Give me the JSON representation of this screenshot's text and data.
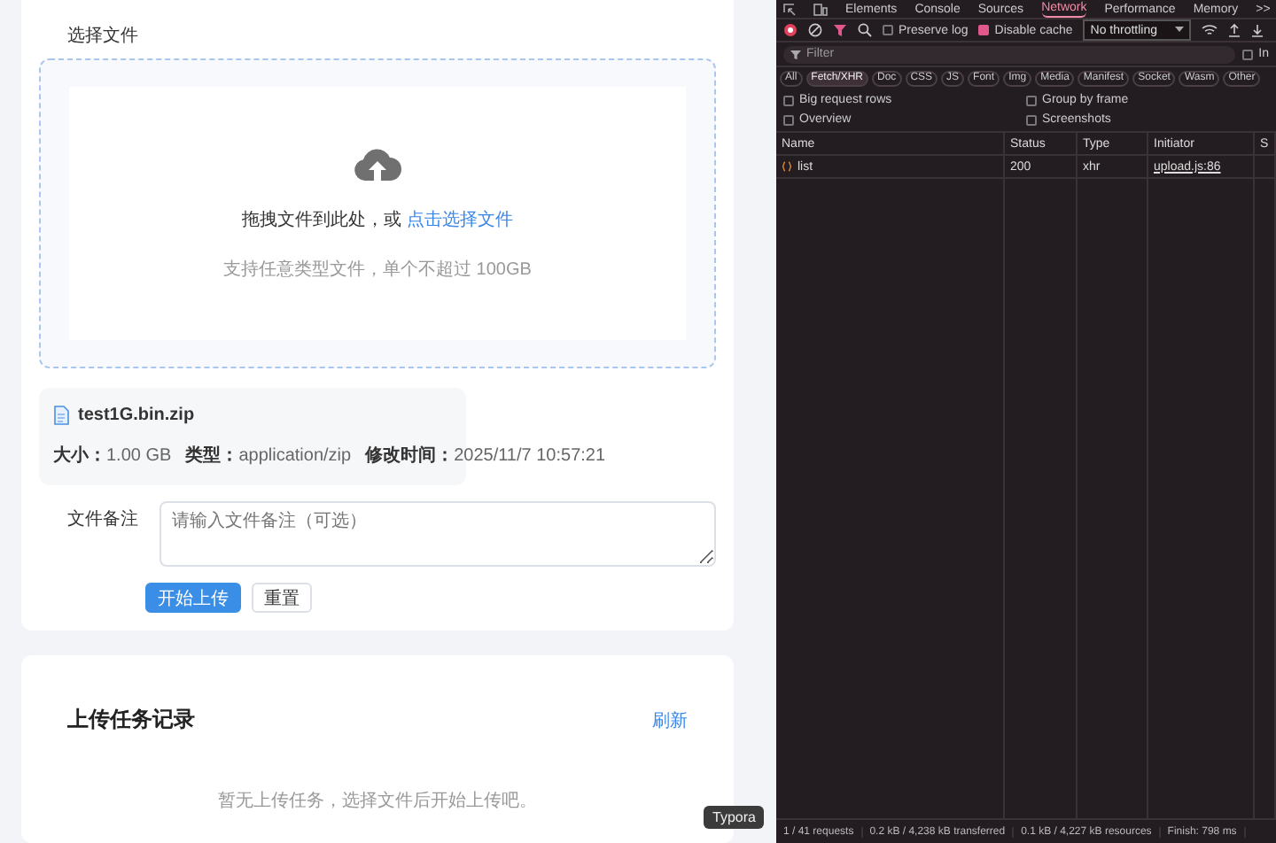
{
  "upload_card": {
    "section_label": "选择文件",
    "drop_text": "拖拽文件到此处，或",
    "drop_link": "点击选择文件",
    "drop_hint": "支持任意类型文件，单个不超过 100GB",
    "file": {
      "name": "test1G.bin.zip",
      "meta": [
        {
          "label": "大小：",
          "value": "1.00 GB"
        },
        {
          "label": "类型：",
          "value": "application/zip"
        },
        {
          "label": "修改时间：",
          "value": "2025/11/7 10:57:21"
        }
      ]
    },
    "remark_label": "文件备注",
    "remark_placeholder": "请输入文件备注（可选）",
    "buttons": [
      {
        "label": "开始上传",
        "kind": "primary"
      },
      {
        "label": "重置",
        "kind": "default"
      }
    ]
  },
  "tasks_card": {
    "title": "上传任务记录",
    "refresh": "刷新",
    "empty_text": "暂无上传任务，选择文件后开始上传吧。"
  },
  "tooltip": "Typora",
  "devtools": {
    "tabs": [
      {
        "label": "Elements",
        "selected": false
      },
      {
        "label": "Console",
        "selected": false
      },
      {
        "label": "Sources",
        "selected": false
      },
      {
        "label": "Network",
        "selected": true
      },
      {
        "label": "Performance",
        "selected": false
      },
      {
        "label": "Memory",
        "selected": false
      }
    ],
    "more_tabs": ">>",
    "toolbar_checks": [
      {
        "label": "Preserve log",
        "checked": false
      },
      {
        "label": "Disable cache",
        "checked": true
      }
    ],
    "throttling": "No throttling",
    "filter_placeholder": "Filter",
    "filter_side": "In",
    "filter_side_checked": false,
    "chips": [
      {
        "label": "All",
        "selected": false
      },
      {
        "label": "Fetch/XHR",
        "selected": true
      },
      {
        "label": "Doc",
        "selected": false
      },
      {
        "label": "CSS",
        "selected": false
      },
      {
        "label": "JS",
        "selected": false
      },
      {
        "label": "Font",
        "selected": false
      },
      {
        "label": "Img",
        "selected": false
      },
      {
        "label": "Media",
        "selected": false
      },
      {
        "label": "Manifest",
        "selected": false
      },
      {
        "label": "Socket",
        "selected": false
      },
      {
        "label": "Wasm",
        "selected": false
      },
      {
        "label": "Other",
        "selected": false
      }
    ],
    "options": [
      {
        "label": "Big request rows",
        "checked": false
      },
      {
        "label": "Group by frame",
        "checked": false
      },
      {
        "label": "Overview",
        "checked": false
      },
      {
        "label": "Screenshots",
        "checked": false
      }
    ],
    "table": {
      "columns": [
        "Name",
        "Status",
        "Type",
        "Initiator",
        "S"
      ],
      "rows": [
        {
          "name": "list",
          "status": "200",
          "type": "xhr",
          "initiator": "upload.js:86"
        }
      ]
    },
    "status_bar": [
      "1 / 41 requests",
      "0.2 kB / 4,238 kB transferred",
      "0.1 kB / 4,227 kB resources",
      "Finish: 798 ms"
    ]
  }
}
